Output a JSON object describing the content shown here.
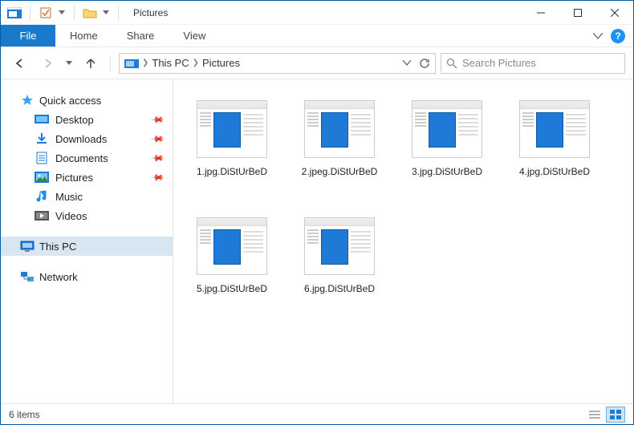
{
  "title": "Pictures",
  "ribbon": {
    "file": "File",
    "tabs": [
      "Home",
      "Share",
      "View"
    ]
  },
  "breadcrumbs": [
    "This PC",
    "Pictures"
  ],
  "search": {
    "placeholder": "Search Pictures"
  },
  "sidebar": {
    "quick_access": {
      "label": "Quick access",
      "items": [
        {
          "label": "Desktop",
          "icon": "desktop"
        },
        {
          "label": "Downloads",
          "icon": "downloads"
        },
        {
          "label": "Documents",
          "icon": "documents"
        },
        {
          "label": "Pictures",
          "icon": "pictures"
        },
        {
          "label": "Music",
          "icon": "music"
        },
        {
          "label": "Videos",
          "icon": "videos"
        }
      ]
    },
    "this_pc": {
      "label": "This PC"
    },
    "network": {
      "label": "Network"
    }
  },
  "files": [
    {
      "name": "1.jpg.DiStUrBeD"
    },
    {
      "name": "2.jpeg.DiStUrBeD"
    },
    {
      "name": "3.jpg.DiStUrBeD"
    },
    {
      "name": "4.jpg.DiStUrBeD"
    },
    {
      "name": "5.jpg.DiStUrBeD"
    },
    {
      "name": "6.jpg.DiStUrBeD"
    }
  ],
  "status": {
    "count_text": "6 items"
  }
}
